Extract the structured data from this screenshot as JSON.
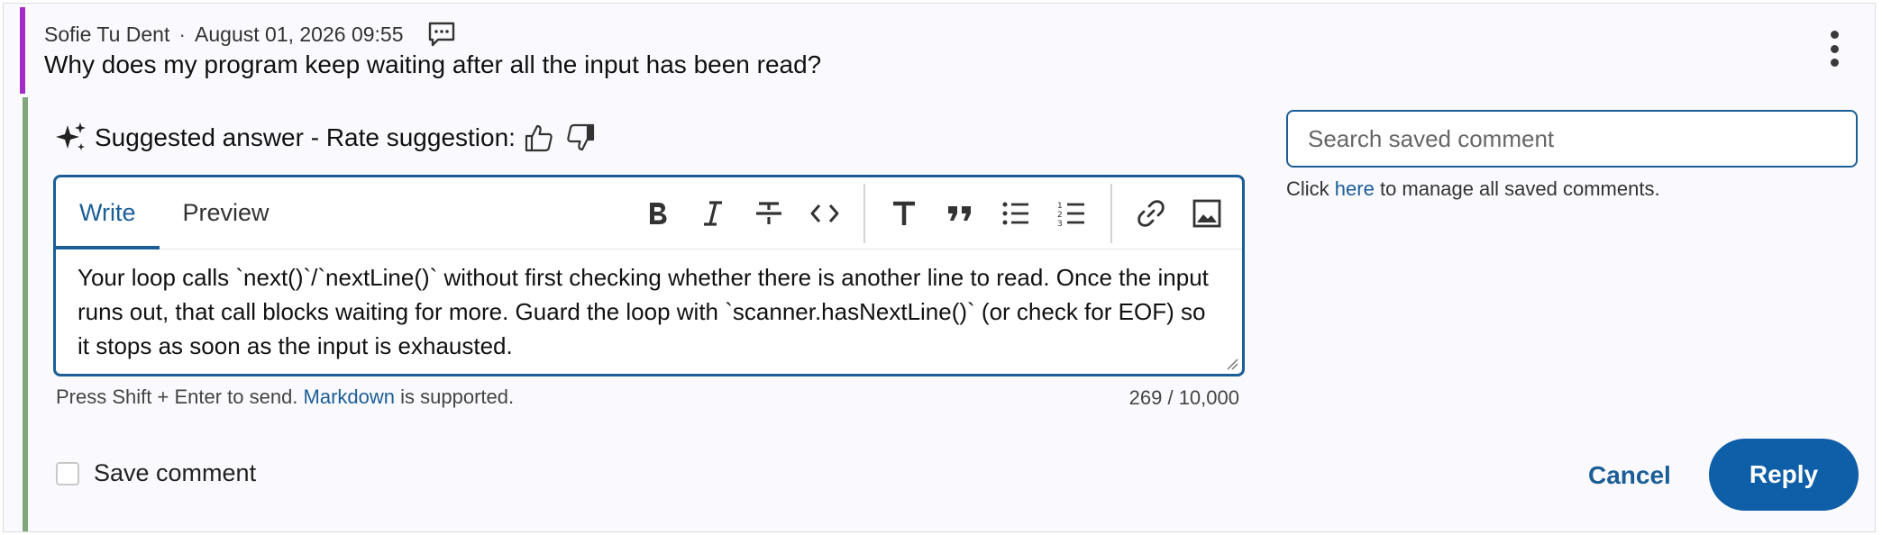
{
  "question": {
    "author": "Sofie Tu Dent",
    "separator": "·",
    "timestamp": "August 01, 2026 09:55",
    "text": "Why does my program keep waiting after all the input has been read?"
  },
  "suggestion": {
    "label": "Suggested answer - Rate suggestion:"
  },
  "editor": {
    "tabs": [
      "Write",
      "Preview"
    ],
    "active_tab": "Write",
    "body": "Your loop calls `next()`/`nextLine()` without first checking whether there is another line to read. Once the input runs out, that call blocks waiting for more. Guard the loop with `scanner.hasNextLine()` (or check for EOF) so it stops as soon as the input is exhausted.",
    "hint_before": "Press Shift + Enter to send.",
    "hint_link": "Markdown",
    "hint_after": "is supported.",
    "char_count": "269 / 10,000"
  },
  "save_comment_label": "Save comment",
  "saved_comments": {
    "search_placeholder": "Search saved comment",
    "manage_before": "Click",
    "manage_link": "here",
    "manage_after": "to manage all saved comments."
  },
  "actions": {
    "cancel": "Cancel",
    "reply": "Reply"
  },
  "colors": {
    "accent": "#1b5e96",
    "question_bar": "#a32cc4",
    "answer_bar": "#7fa77a",
    "reply_button": "#0f5ea8"
  }
}
